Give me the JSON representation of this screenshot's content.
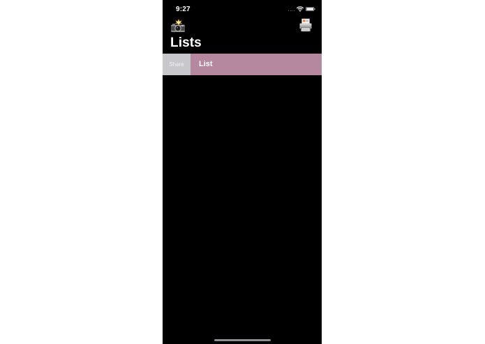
{
  "status_bar": {
    "time": "9:27",
    "signal_icon": "cellular-signal-icon",
    "wifi_icon": "wifi-icon",
    "battery_icon": "battery-icon"
  },
  "nav": {
    "left_icon": "camera-flash-icon",
    "right_icon": "printer-icon",
    "title": "Lists"
  },
  "lists": {
    "rows": [
      {
        "label": "List",
        "swipe_action": "Share",
        "color": "#b5889f"
      }
    ]
  },
  "colors": {
    "background": "#000000",
    "share_action": "#c7c7cc",
    "row_accent": "#b5889f"
  }
}
